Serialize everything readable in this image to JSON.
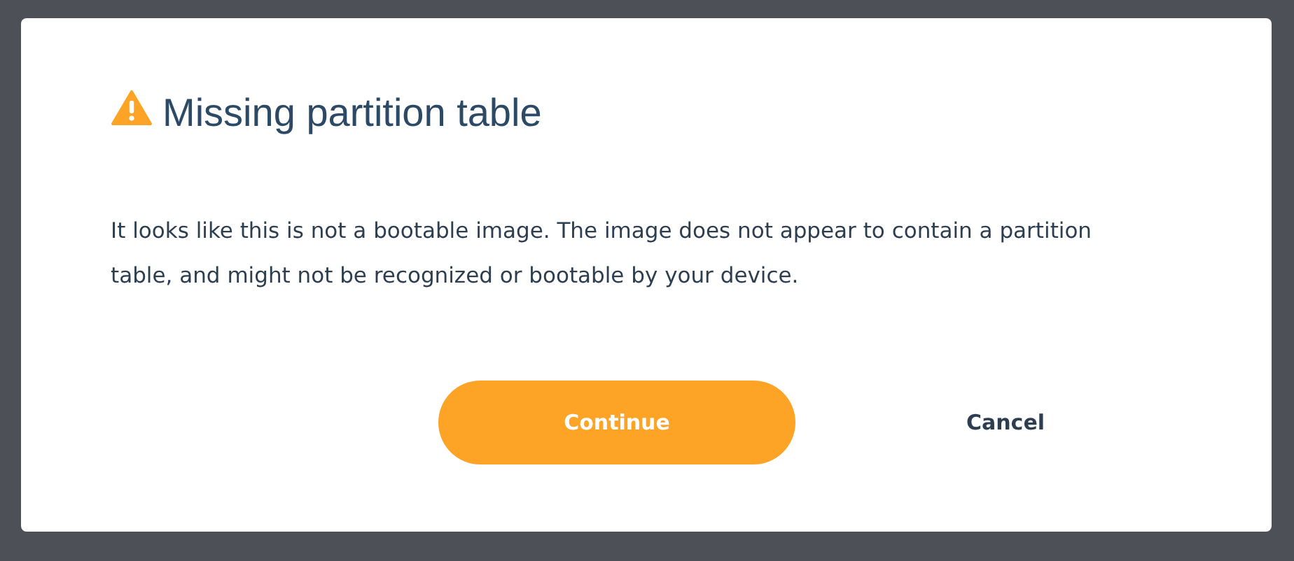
{
  "dialog": {
    "title": "Missing partition table",
    "message": "It looks like this is not a bootable image. The image does not appear to contain a partition table, and might not be recognized or bootable by your device.",
    "buttons": [
      {
        "label": "Continue",
        "kind": "primary"
      },
      {
        "label": "Cancel",
        "kind": "secondary"
      }
    ]
  }
}
